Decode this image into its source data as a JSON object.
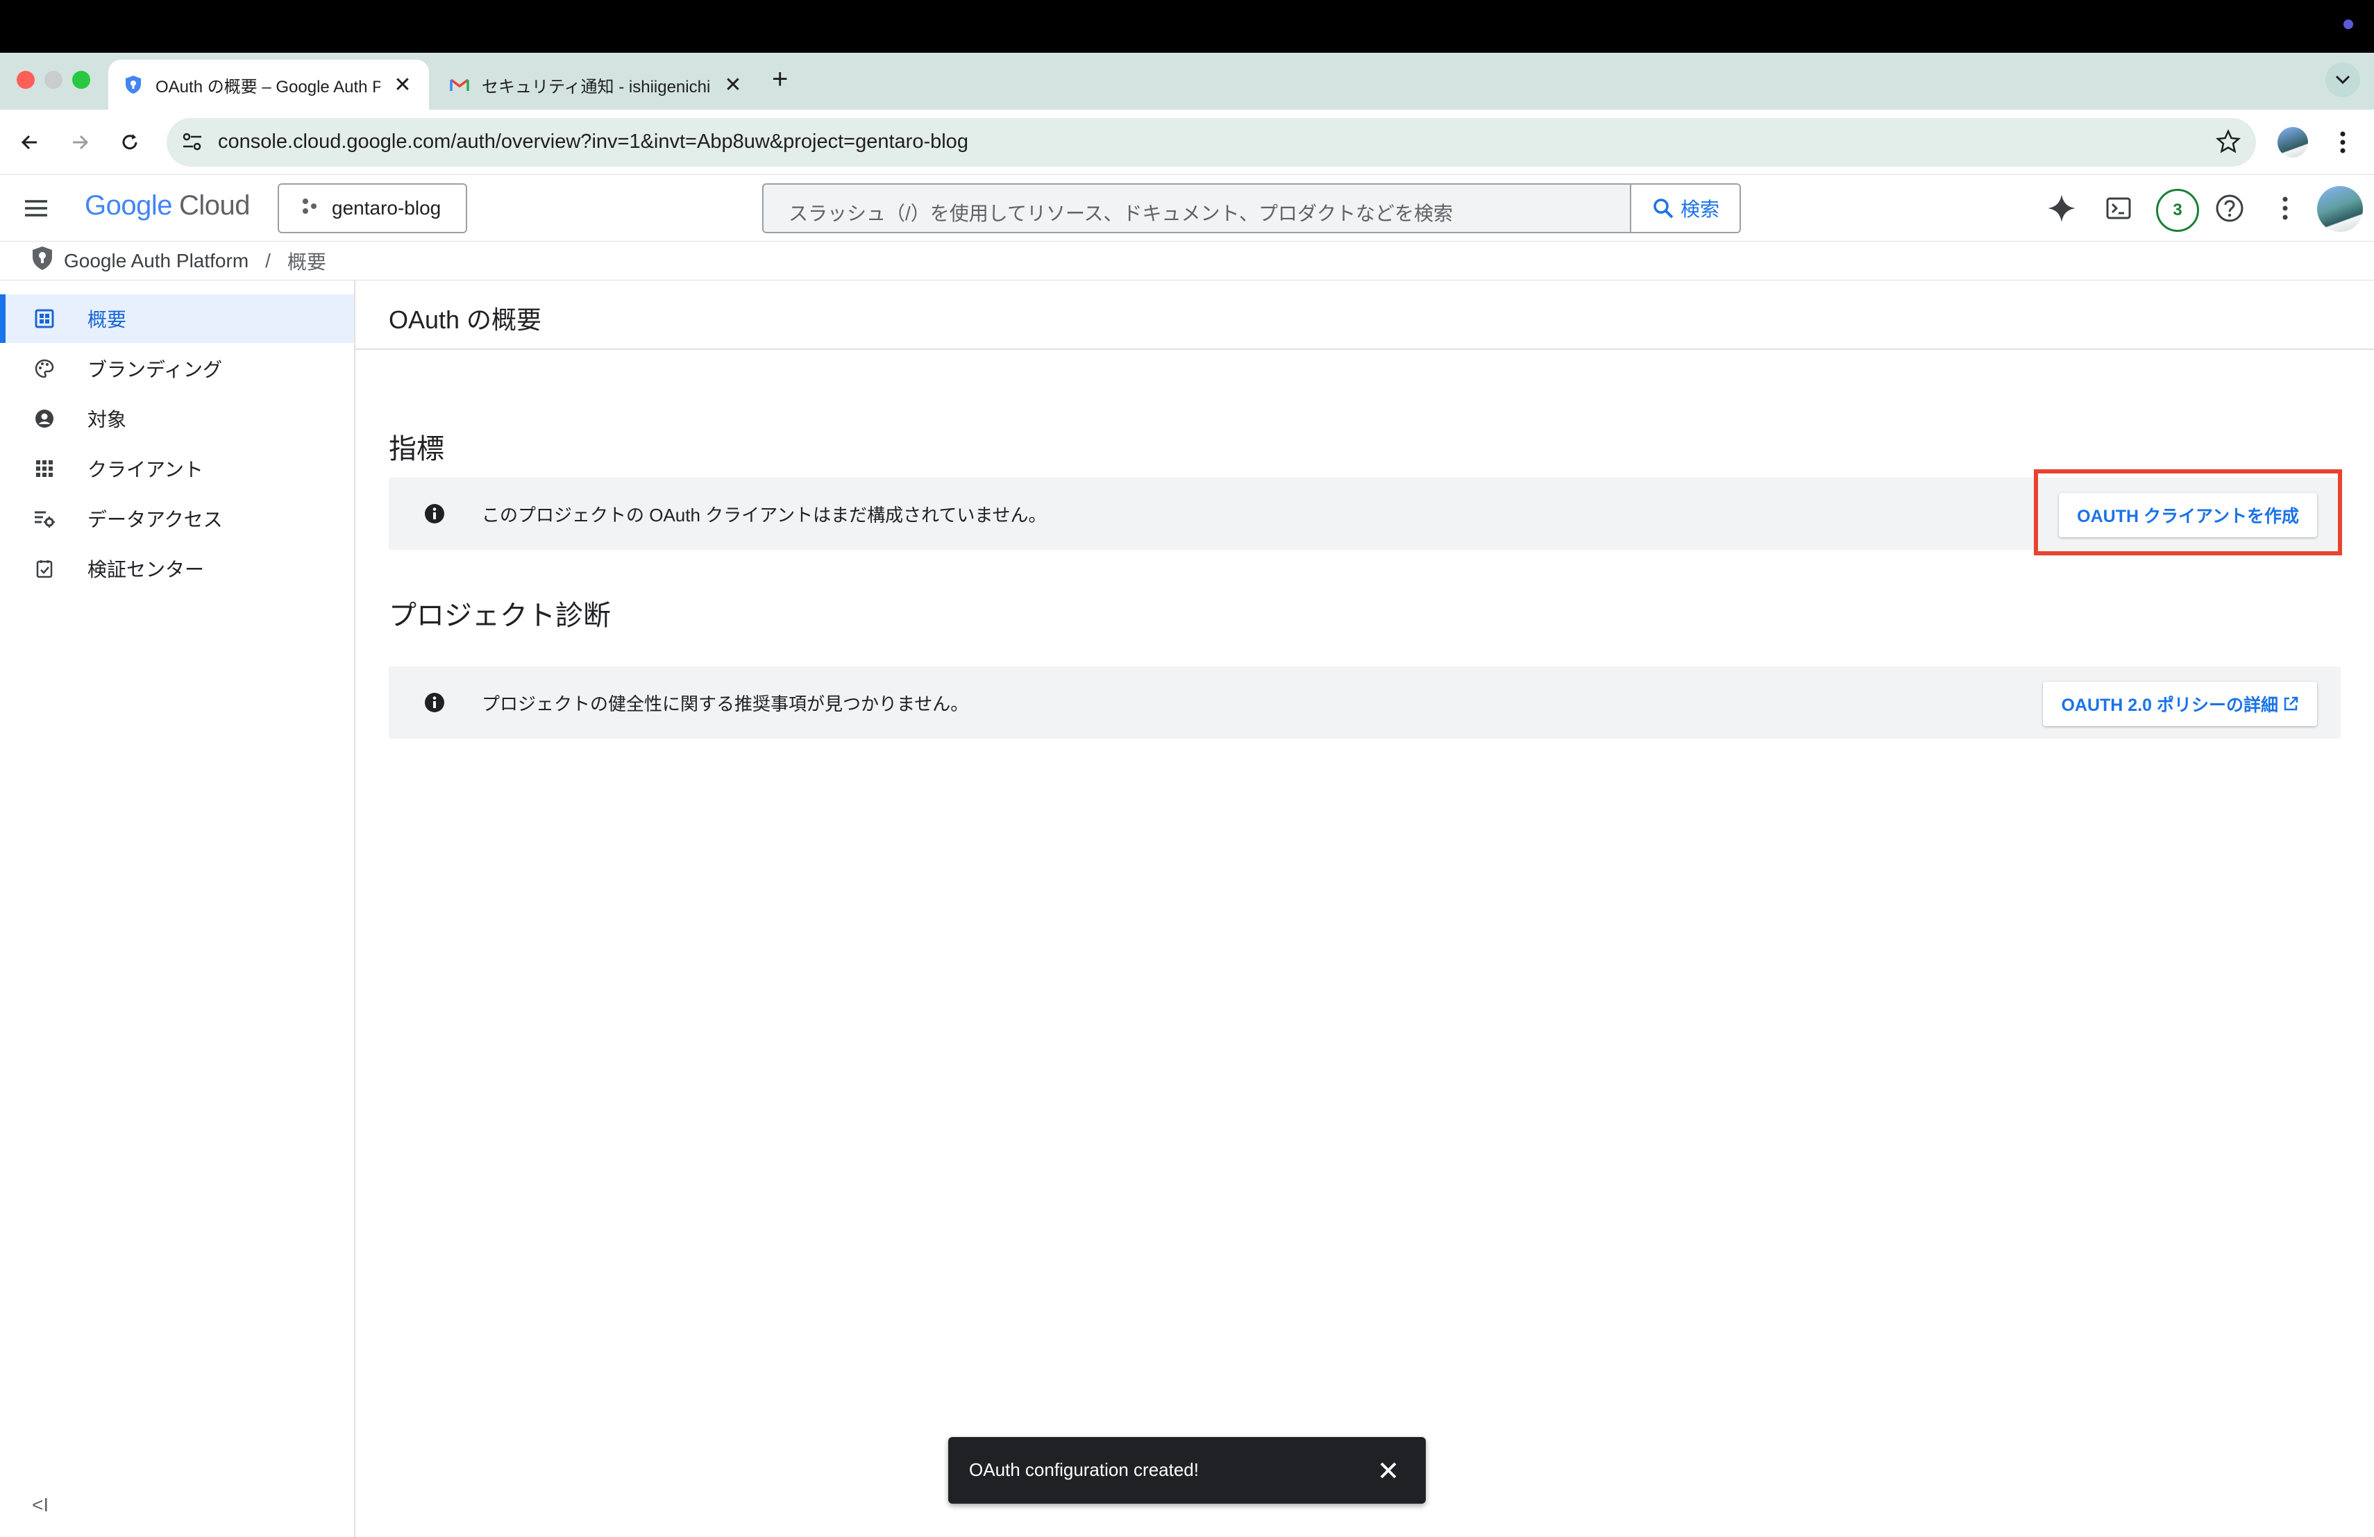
{
  "browser": {
    "tabs": [
      {
        "title": "OAuth の概要 – Google Auth P",
        "active": true
      },
      {
        "title": "セキュリティ通知 - ishiigenichi",
        "active": false
      }
    ],
    "new_tab_label": "+",
    "url": "console.cloud.google.com/auth/overview?inv=1&invt=Abp8uw&project=gentaro-blog"
  },
  "header": {
    "logo_google": "Google",
    "logo_cloud": "Cloud",
    "project": "gentaro-blog",
    "search_placeholder": "スラッシュ（/）を使用してリソース、ドキュメント、プロダクトなどを検索",
    "search_button": "検索",
    "notification_count": "3"
  },
  "breadcrumb": {
    "root": "Google Auth Platform",
    "separator": "/",
    "current": "概要"
  },
  "sidebar": {
    "items": [
      {
        "label": "概要",
        "icon": "dashboard-icon",
        "active": true
      },
      {
        "label": "ブランディング",
        "icon": "palette-icon",
        "active": false
      },
      {
        "label": "対象",
        "icon": "account-circle-icon",
        "active": false
      },
      {
        "label": "クライアント",
        "icon": "apps-grid-icon",
        "active": false
      },
      {
        "label": "データアクセス",
        "icon": "data-settings-icon",
        "active": false
      },
      {
        "label": "検証センター",
        "icon": "checklist-icon",
        "active": false
      }
    ],
    "collapse_label": "<I"
  },
  "main": {
    "title": "OAuth の概要",
    "metrics": {
      "heading": "指標",
      "message": "このプロジェクトの OAuth クライアントはまだ構成されていません。",
      "button": "OAUTH クライアントを作成"
    },
    "diagnostics": {
      "heading": "プロジェクト診断",
      "message": "プロジェクトの健全性に関する推奨事項が見つかりません。",
      "button": "OAUTH 2.0 ポリシーの詳細"
    }
  },
  "snackbar": {
    "message": "OAuth configuration created!"
  },
  "colors": {
    "accent": "#1a73e8",
    "highlight": "#e8432e",
    "tabstrip": "#d3e3e0",
    "omnibox": "#e3ede9"
  }
}
